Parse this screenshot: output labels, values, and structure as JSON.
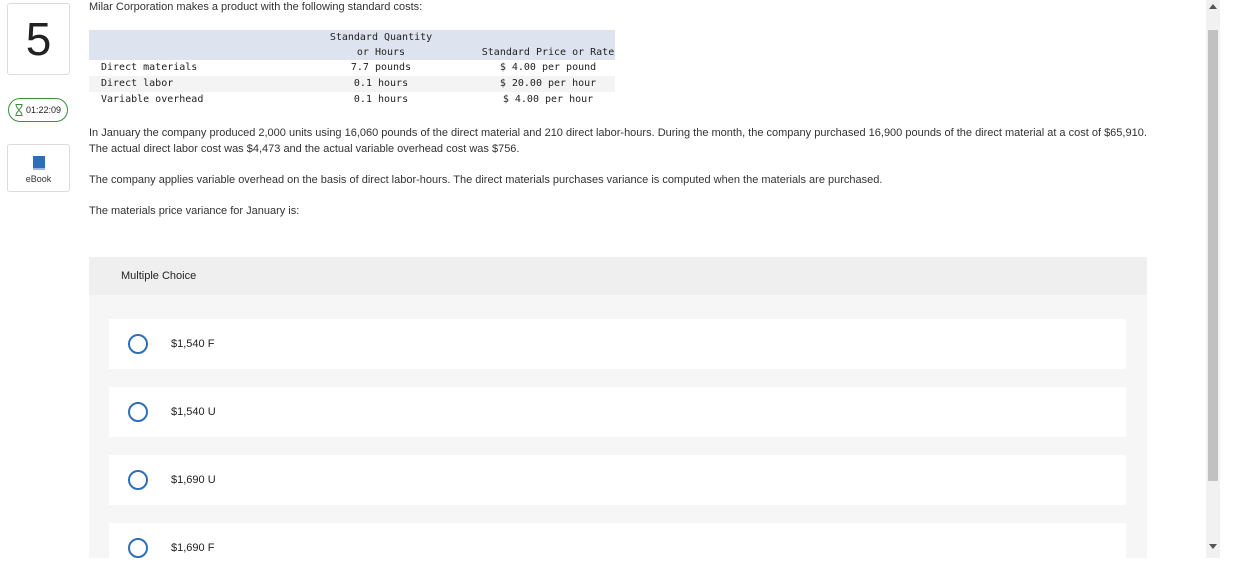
{
  "question": {
    "number": "5"
  },
  "timer": {
    "value": "01:22:09",
    "icon": "hourglass-icon"
  },
  "ebook": {
    "label": "eBook",
    "icon": "book-icon"
  },
  "intro": "Milar Corporation makes a product with the following standard costs:",
  "cost_table": {
    "header_line1": "Standard Quantity",
    "header_line2": "or Hours",
    "header_col3": "Standard Price or Rate",
    "rows": [
      {
        "item": "Direct materials",
        "quantity": "7.7 pounds",
        "rate": "$ 4.00 per pound"
      },
      {
        "item": "Direct labor",
        "quantity": "0.1 hours",
        "rate": "$ 20.00 per hour"
      },
      {
        "item": "Variable overhead",
        "quantity": "0.1 hours",
        "rate": "$ 4.00 per hour"
      }
    ]
  },
  "paragraphs": [
    "In January the company produced 2,000 units using 16,060 pounds of the direct material and 210 direct labor-hours. During the month, the company purchased 16,900 pounds of the direct material at a cost of $65,910. The actual direct labor cost was $4,473 and the actual variable overhead cost was $756.",
    "The company applies variable overhead on the basis of direct labor-hours. The direct materials purchases variance is computed when the materials are purchased.",
    "The materials price variance for January is:"
  ],
  "multiple_choice": {
    "label": "Multiple Choice",
    "options": [
      "$1,540 F",
      "$1,540 U",
      "$1,690 U",
      "$1,690 F"
    ]
  },
  "colors": {
    "radio": "#2e6fb5",
    "timer_border": "#3e8e3e",
    "table_header": "#dde3ef",
    "ebook_icon": "#2f6db7"
  }
}
